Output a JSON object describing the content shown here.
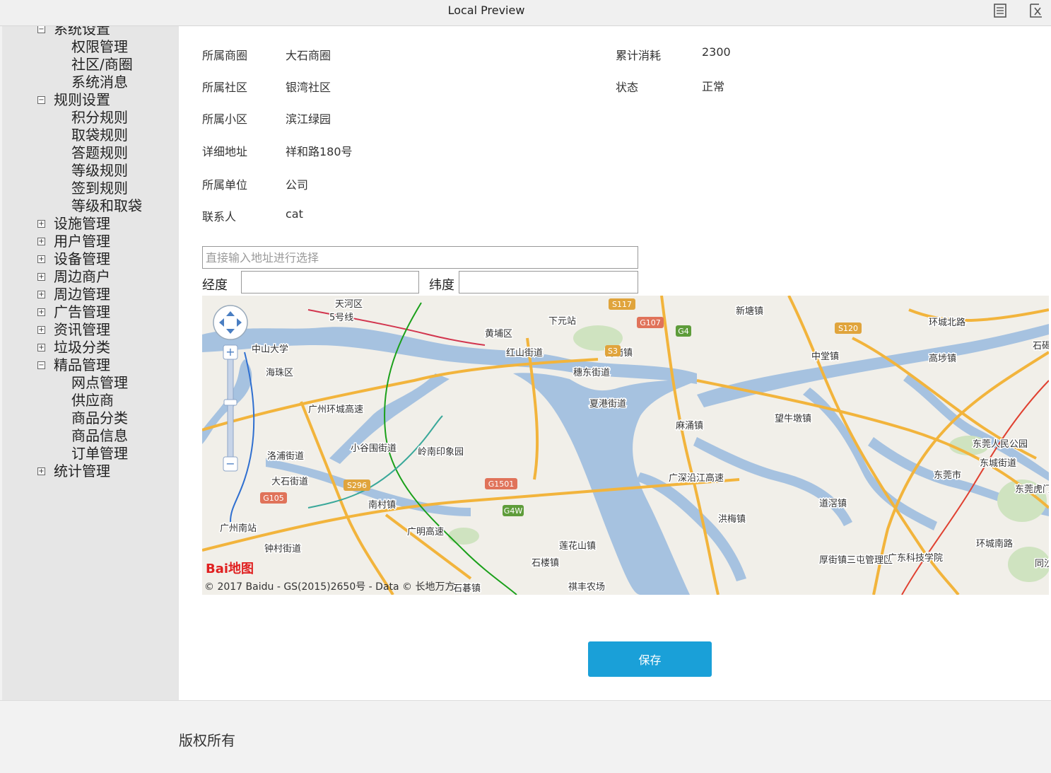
{
  "window": {
    "title": "Local Preview",
    "icons": [
      "document-icon",
      "close-window-icon"
    ]
  },
  "sidebar": {
    "items": [
      {
        "label": "系统设置",
        "expanded": true
      },
      {
        "label": "权限管理",
        "sub": true
      },
      {
        "label": "社区/商圈",
        "sub": true
      },
      {
        "label": "系统消息",
        "sub": true
      },
      {
        "label": "规则设置",
        "expanded": true
      },
      {
        "label": "积分规则",
        "sub": true
      },
      {
        "label": "取袋规则",
        "sub": true
      },
      {
        "label": "答题规则",
        "sub": true
      },
      {
        "label": "等级规则",
        "sub": true
      },
      {
        "label": "签到规则",
        "sub": true
      },
      {
        "label": "等级和取袋",
        "sub": true
      },
      {
        "label": "设施管理",
        "expanded": false
      },
      {
        "label": "用户管理",
        "expanded": false
      },
      {
        "label": "设备管理",
        "expanded": false
      },
      {
        "label": "周边商户",
        "expanded": false
      },
      {
        "label": "周边管理",
        "expanded": false
      },
      {
        "label": "广告管理",
        "expanded": false
      },
      {
        "label": "资讯管理",
        "expanded": false
      },
      {
        "label": "垃圾分类",
        "expanded": false
      },
      {
        "label": "精品管理",
        "expanded": true
      },
      {
        "label": "网点管理",
        "sub": true
      },
      {
        "label": "供应商",
        "sub": true
      },
      {
        "label": "商品分类",
        "sub": true
      },
      {
        "label": "商品信息",
        "sub": true
      },
      {
        "label": "订单管理",
        "sub": true
      },
      {
        "label": "统计管理",
        "expanded": false
      }
    ]
  },
  "details": {
    "left": [
      {
        "label": "所属商圈",
        "value": "大石商圈"
      },
      {
        "label": "所属社区",
        "value": "银湾社区"
      },
      {
        "label": "所属小区",
        "value": "滨江绿园"
      },
      {
        "label": "详细地址",
        "value": "祥和路180号"
      },
      {
        "label": "所属单位",
        "value": "公司"
      },
      {
        "label": "联系人",
        "value": "cat"
      }
    ],
    "right": [
      {
        "label": "累计消耗",
        "value": "2300"
      },
      {
        "label": "状态",
        "value": "正常"
      }
    ]
  },
  "address": {
    "placeholder": "直接输入地址进行选择",
    "value": ""
  },
  "coords": {
    "lng_label": "经度",
    "lat_label": "纬度",
    "lng": "",
    "lat": ""
  },
  "map": {
    "places": [
      "天河区",
      "5号线",
      "黄埔区",
      "下元站",
      "中山大学",
      "海珠区",
      "红山街道",
      "穗东街道",
      "南岗镇",
      "新塘镇",
      "中堂镇",
      "高埗镇",
      "环城北路",
      "夏港街道",
      "麻涌镇",
      "望牛墩镇",
      "东莞人民公园",
      "东城街道",
      "东莞市",
      "小谷围街道",
      "岭南印象园",
      "洛浦街道",
      "大石街道",
      "南村镇",
      "广州南站",
      "钟村街道",
      "莲花山镇",
      "石楼镇",
      "洪梅镇",
      "道滘镇",
      "厚街镇三屯管理区",
      "广东科技学院",
      "环城南路",
      "广州环城高速",
      "广明高速",
      "广深沿江高速",
      "石碁镇",
      "祺丰农场",
      "石碣",
      "东莞虎门郊野公园",
      "同沙"
    ],
    "shields": [
      "S117",
      "G107",
      "G4",
      "S3",
      "S120",
      "G105",
      "S296",
      "G1501",
      "G4W"
    ],
    "logo": "Bai地图",
    "copyright": "© 2017 Baidu - GS(2015)2650号 - Data © 长地万方"
  },
  "actions": {
    "save_label": "保存"
  },
  "footer": {
    "text": "版权所有"
  },
  "colors": {
    "primary": "#1aa0d8",
    "sidebar_bg": "#e6e6e6",
    "map_water": "#a6c2e0",
    "map_road": "#f2b43c"
  }
}
